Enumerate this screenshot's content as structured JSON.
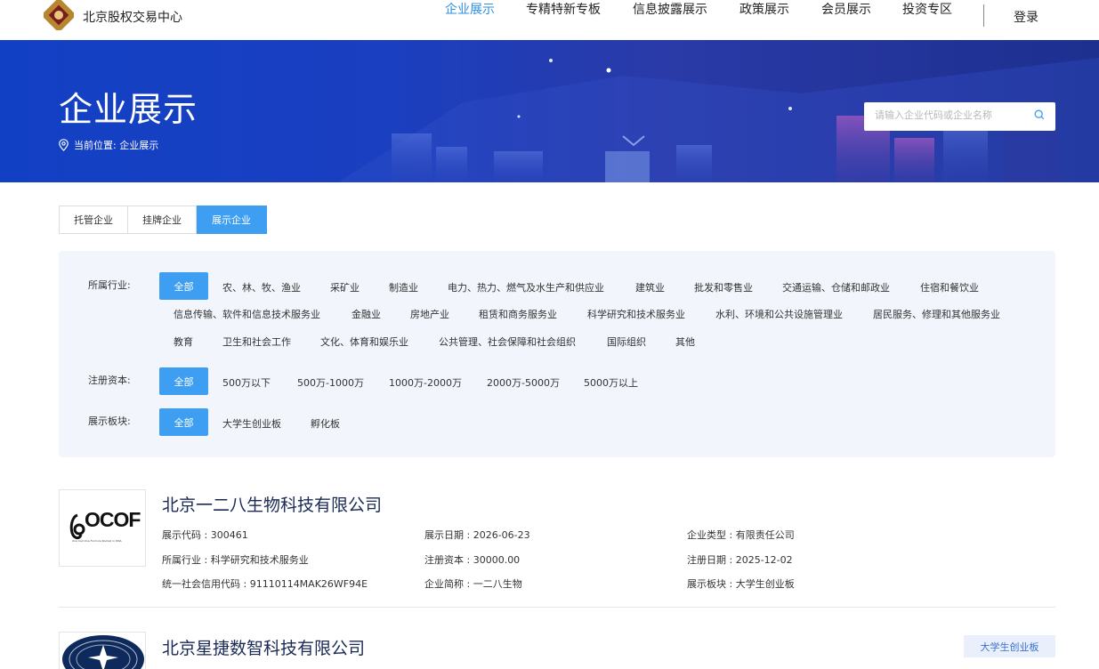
{
  "header": {
    "logo_text": "北京股权交易中心",
    "nav": [
      "企业展示",
      "专精特新专板",
      "信息披露展示",
      "政策展示",
      "会员展示",
      "投资专区"
    ],
    "login": "登录"
  },
  "banner": {
    "title": "企业展示",
    "breadcrumb": "当前位置: 企业展示",
    "search_placeholder": "请输入企业代码或企业名称"
  },
  "tabs": [
    "托管企业",
    "挂牌企业",
    "展示企业"
  ],
  "active_tab": "展示企业",
  "filters": {
    "industry": {
      "label": "所属行业:",
      "all": "全部",
      "options": [
        "农、林、牧、渔业",
        "采矿业",
        "制造业",
        "电力、热力、燃气及水生产和供应业",
        "建筑业",
        "批发和零售业",
        "交通运输、仓储和邮政业",
        "住宿和餐饮业",
        "信息传输、软件和信息技术服务业",
        "金融业",
        "房地产业",
        "租赁和商务服务业",
        "科学研究和技术服务业",
        "水利、环境和公共设施管理业",
        "居民服务、修理和其他服务业",
        "教育",
        "卫生和社会工作",
        "文化、体育和娱乐业",
        "公共管理、社会保障和社会组织",
        "国际组织",
        "其他"
      ]
    },
    "capital": {
      "label": "注册资本:",
      "all": "全部",
      "options": [
        "500万以下",
        "500万-1000万",
        "1000万-2000万",
        "2000万-5000万",
        "5000万以上"
      ]
    },
    "board": {
      "label": "展示板块:",
      "all": "全部",
      "options": [
        "大学生创业板",
        "孵化板"
      ]
    }
  },
  "companies": [
    {
      "name": "北京一二八生物科技有限公司",
      "logo_text": "OCOF",
      "logo_sub": "One Cell One Formula Rooted in DNA",
      "fields": [
        "展示代码 : 300461",
        "展示日期 : 2026-06-23",
        "企业类型 : 有限责任公司",
        "所属行业 : 科学研究和技术服务业",
        "注册资本 : 30000.00",
        "注册日期 : 2025-12-02",
        "统一社会信用代码 : 91110114MAK26WF94E",
        "企业简称 : 一二八生物",
        "展示板块 : 大学生创业板"
      ]
    },
    {
      "name": "北京星捷数智科技有限公司",
      "badge": "大学生创业板"
    }
  ],
  "colors": {
    "accent": "#3d9ef2",
    "nav_active": "#2b8fe0",
    "banner": "#1a3fc0",
    "filter_bg": "#f2f5fc",
    "company_name": "#1a2a55"
  }
}
